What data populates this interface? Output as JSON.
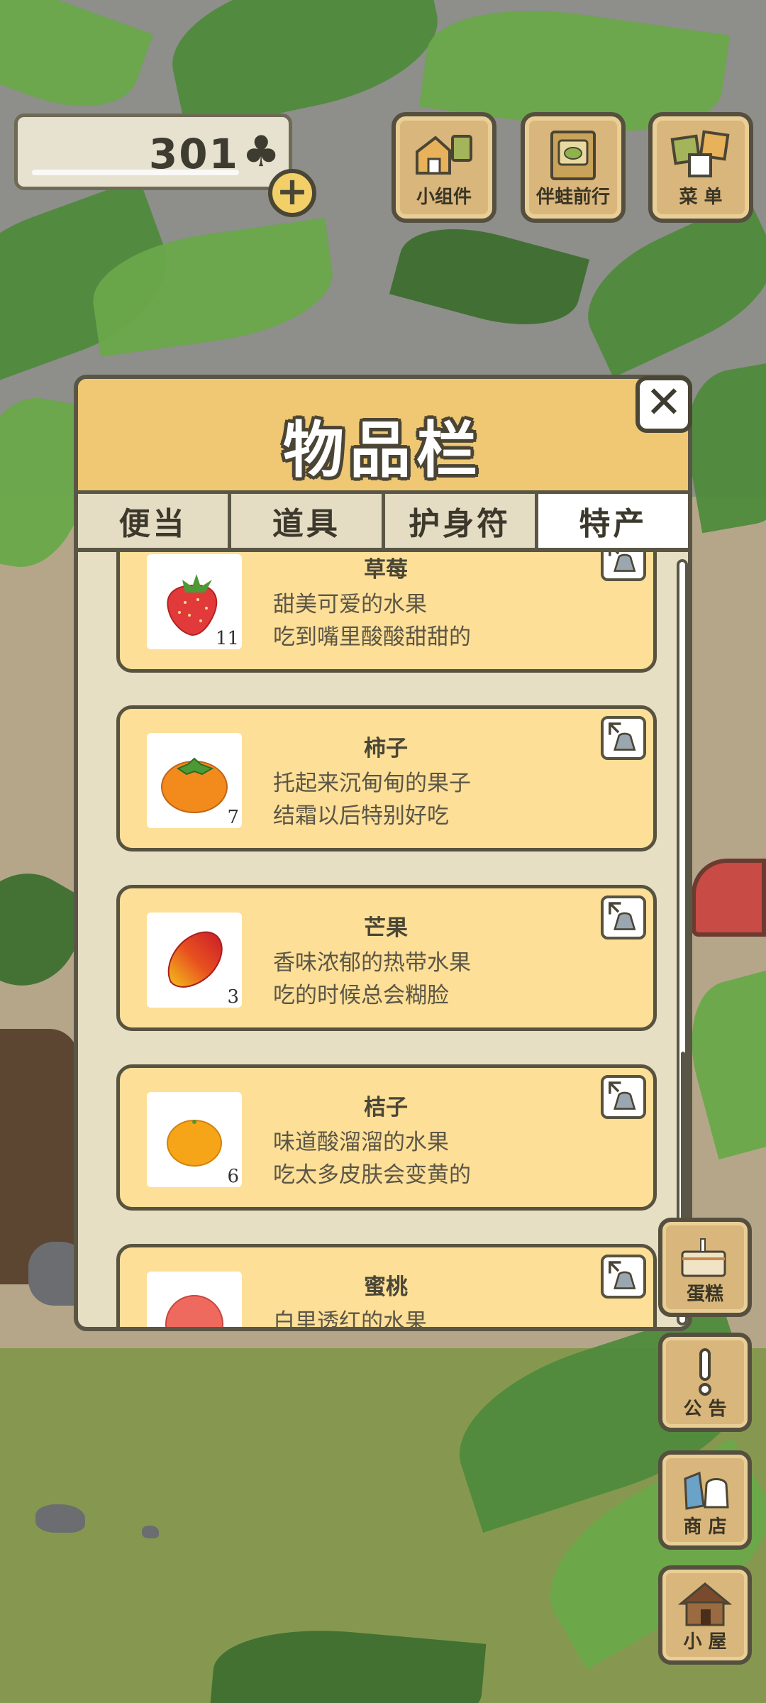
{
  "currency": {
    "clover_count": "301",
    "clover_symbol": "♣",
    "add_symbol": "+"
  },
  "top_buttons": [
    {
      "label": "小组件",
      "icon": "widget-icon"
    },
    {
      "label": "伴蛙前行",
      "icon": "frog-journey-icon"
    },
    {
      "label": "菜 单",
      "icon": "menu-icon"
    }
  ],
  "inventory": {
    "title": "物品栏",
    "close_symbol": "✕",
    "tabs": [
      {
        "label": "便当",
        "active": false
      },
      {
        "label": "道具",
        "active": false
      },
      {
        "label": "护身符",
        "active": false
      },
      {
        "label": "特产",
        "active": true
      }
    ],
    "items": [
      {
        "name": "草莓",
        "count": "11",
        "desc1": "甜美可爱的水果",
        "desc2": "吃到嘴里酸酸甜甜的",
        "icon": "strawberry-icon"
      },
      {
        "name": "柿子",
        "count": "7",
        "desc1": "托起来沉甸甸的果子",
        "desc2": "结霜以后特别好吃",
        "icon": "persimmon-icon"
      },
      {
        "name": "芒果",
        "count": "3",
        "desc1": "香味浓郁的热带水果",
        "desc2": "吃的时候总会糊脸",
        "icon": "mango-icon"
      },
      {
        "name": "桔子",
        "count": "6",
        "desc1": "味道酸溜溜的水果",
        "desc2": "吃太多皮肤会变黄的",
        "icon": "tangerine-icon"
      },
      {
        "name": "蜜桃",
        "count": "",
        "desc1": "白里透红的水果",
        "desc2": "",
        "icon": "peach-icon"
      }
    ]
  },
  "side_buttons": [
    {
      "label": "蛋糕",
      "icon": "cake-icon"
    },
    {
      "label": "公 告",
      "icon": "notice-icon"
    },
    {
      "label": "商 店",
      "icon": "shop-icon"
    },
    {
      "label": "小 屋",
      "icon": "house-icon"
    }
  ]
}
